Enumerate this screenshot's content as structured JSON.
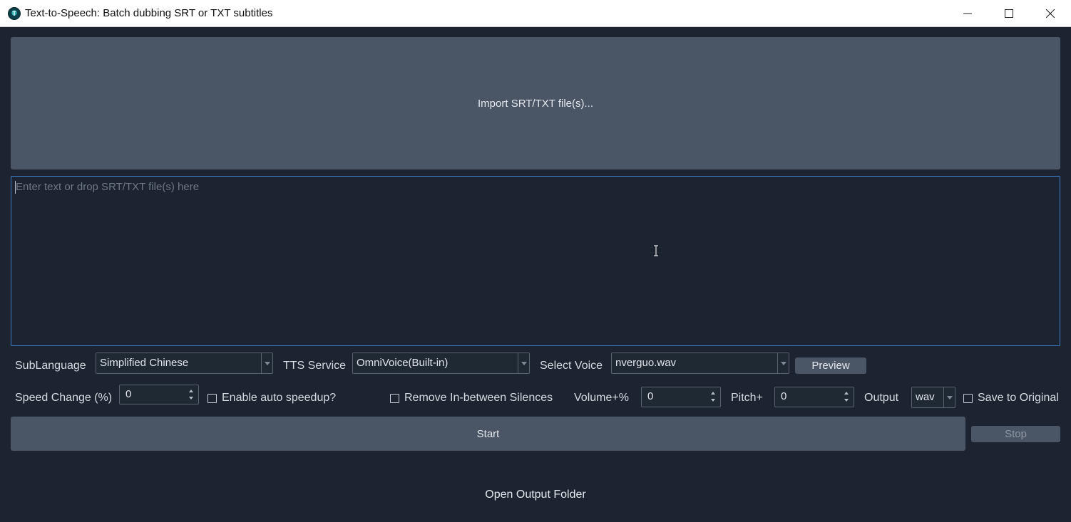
{
  "window": {
    "title": "Text-to-Speech: Batch dubbing SRT or TXT subtitles",
    "app_icon_glyph": "T"
  },
  "import": {
    "label": "Import SRT/TXT file(s)..."
  },
  "text_input": {
    "placeholder": "Enter text or drop SRT/TXT file(s) here"
  },
  "row1": {
    "sublanguage_label": "SubLanguage",
    "sublanguage_value": "Simplified Chinese",
    "tts_service_label": "TTS Service",
    "tts_service_value": "OmniVoice(Built-in)",
    "select_voice_label": "Select Voice",
    "select_voice_value": "nverguo.wav",
    "preview_label": "Preview"
  },
  "row2": {
    "speed_change_label": "Speed Change (%)",
    "speed_change_value": "0",
    "auto_speedup_label": "Enable auto speedup?",
    "remove_silences_label": "Remove In-between Silences",
    "volume_label": "Volume+%",
    "volume_value": "0",
    "pitch_label": "Pitch+",
    "pitch_value": "0",
    "output_label": "Output",
    "output_value": "wav",
    "save_original_label": "Save to Original"
  },
  "actions": {
    "start_label": "Start",
    "stop_label": "Stop",
    "open_folder_label": "Open Output Folder"
  },
  "colors": {
    "background": "#1b2430",
    "button": "#4a5565",
    "focus_border": "#3d7ec4"
  }
}
